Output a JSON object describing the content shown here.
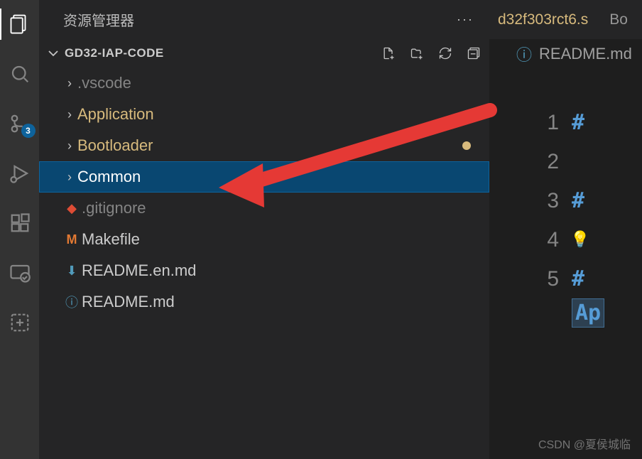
{
  "activityBar": {
    "badge": "3"
  },
  "sidebar": {
    "title": "资源管理器",
    "project": "GD32-IAP-CODE"
  },
  "tree": {
    "items": [
      {
        "name": ".vscode",
        "kind": "folder",
        "dim": true
      },
      {
        "name": "Application",
        "kind": "folder",
        "modified": true
      },
      {
        "name": "Bootloader",
        "kind": "folder",
        "modified": true
      },
      {
        "name": "Common",
        "kind": "folder",
        "selected": true
      },
      {
        "name": ".gitignore",
        "kind": "file",
        "icon": "git",
        "dim": true
      },
      {
        "name": "Makefile",
        "kind": "file",
        "icon": "makefile"
      },
      {
        "name": "README.en.md",
        "kind": "file",
        "icon": "markdown"
      },
      {
        "name": "README.md",
        "kind": "file",
        "icon": "readme"
      }
    ]
  },
  "tabs": {
    "tab1": "d32f303rct6.s",
    "tab2": "Bo"
  },
  "breadcrumb": {
    "file": "README.md"
  },
  "editor": {
    "lines": [
      "1",
      "2",
      "3",
      "4",
      "5"
    ],
    "l1": "#",
    "l3": "#",
    "l5": "#",
    "apToken": "Ap"
  },
  "watermark": "CSDN @夏侯城临"
}
